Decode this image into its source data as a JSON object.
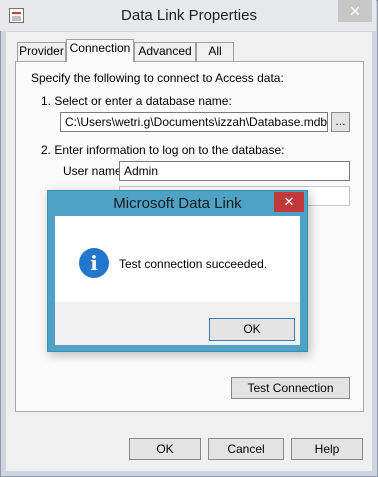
{
  "window": {
    "title": "Data Link Properties",
    "close_glyph": "✕"
  },
  "tabs": [
    {
      "label": "Provider",
      "active": false
    },
    {
      "label": "Connection",
      "active": true
    },
    {
      "label": "Advanced",
      "active": false
    },
    {
      "label": "All",
      "active": false
    }
  ],
  "connection": {
    "intro": "Specify the following to connect to Access data:",
    "step1_label": "1. Select or enter a database name:",
    "database_path": "C:\\Users\\wetri.g\\Documents\\izzah\\Database.mdb",
    "browse_label": "...",
    "step2_label": "2. Enter information to log on to the database:",
    "username_label": "User name:",
    "username_value": "Admin",
    "password_value": "",
    "test_connection_label": "Test Connection"
  },
  "footer": {
    "ok_label": "OK",
    "cancel_label": "Cancel",
    "help_label": "Help"
  },
  "message_box": {
    "title": "Microsoft Data Link",
    "close_glyph": "✕",
    "icon": "info-icon",
    "icon_glyph": "i",
    "message": "Test connection succeeded.",
    "ok_label": "OK"
  }
}
